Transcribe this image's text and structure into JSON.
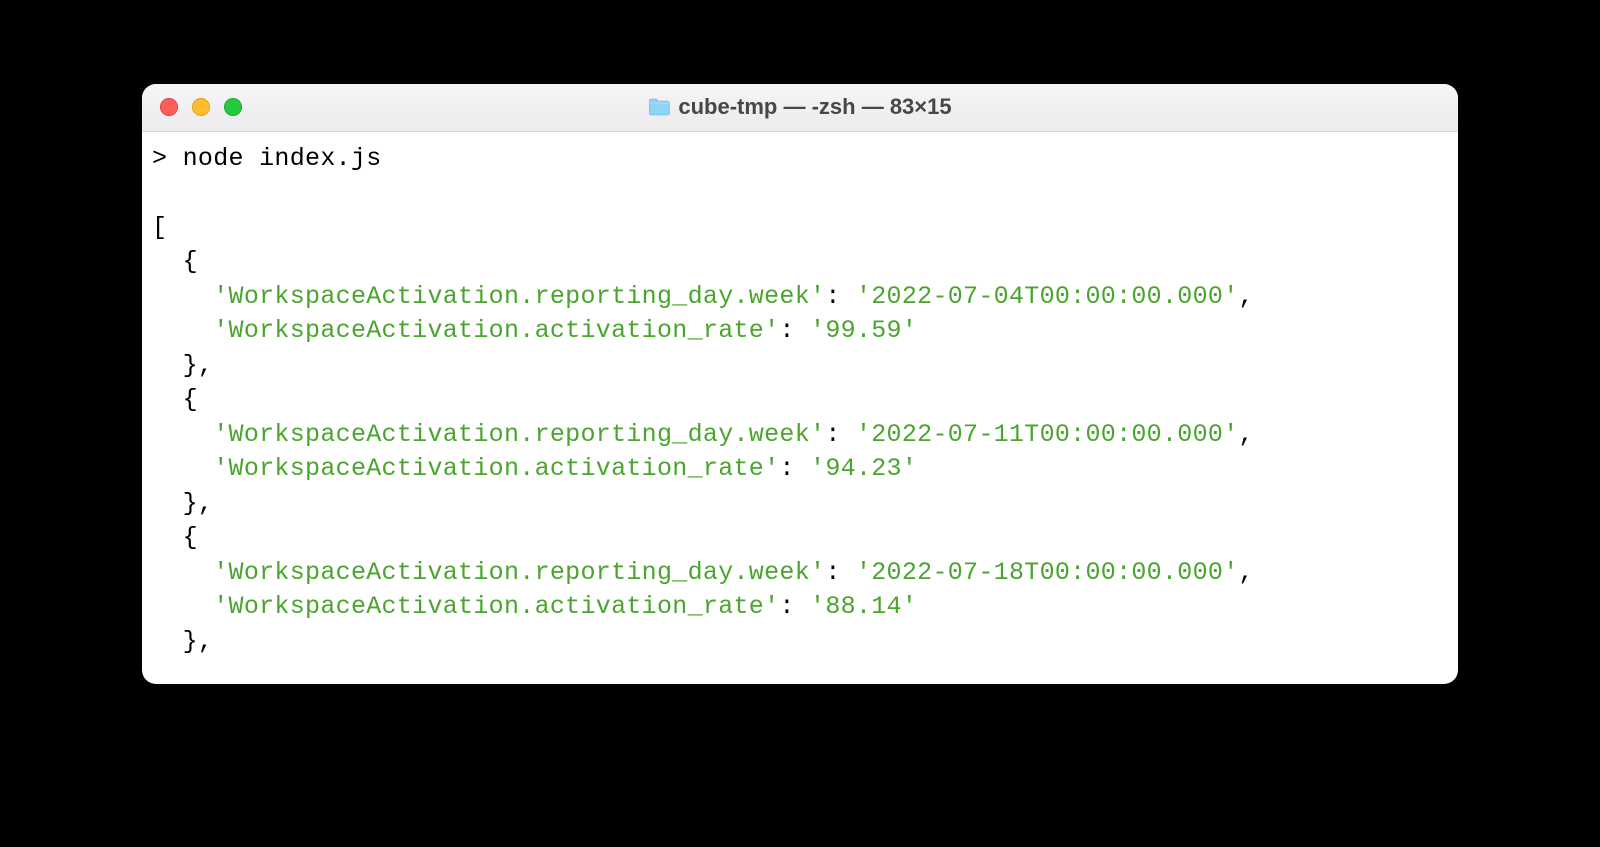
{
  "window": {
    "title": "cube-tmp — -zsh — 83×15"
  },
  "terminal": {
    "prompt": "> ",
    "command": "node index.js",
    "output": {
      "open_bracket": "[",
      "items": [
        {
          "open": "  {",
          "key1": "'WorkspaceActivation.reporting_day.week'",
          "val1": "'2022-07-04T00:00:00.000'",
          "key2": "'WorkspaceActivation.activation_rate'",
          "val2": "'99.59'",
          "close": "  },"
        },
        {
          "open": "  {",
          "key1": "'WorkspaceActivation.reporting_day.week'",
          "val1": "'2022-07-11T00:00:00.000'",
          "key2": "'WorkspaceActivation.activation_rate'",
          "val2": "'94.23'",
          "close": "  },"
        },
        {
          "open": "  {",
          "key1": "'WorkspaceActivation.reporting_day.week'",
          "val1": "'2022-07-18T00:00:00.000'",
          "key2": "'WorkspaceActivation.activation_rate'",
          "val2": "'88.14'",
          "close": "  },"
        }
      ]
    }
  }
}
